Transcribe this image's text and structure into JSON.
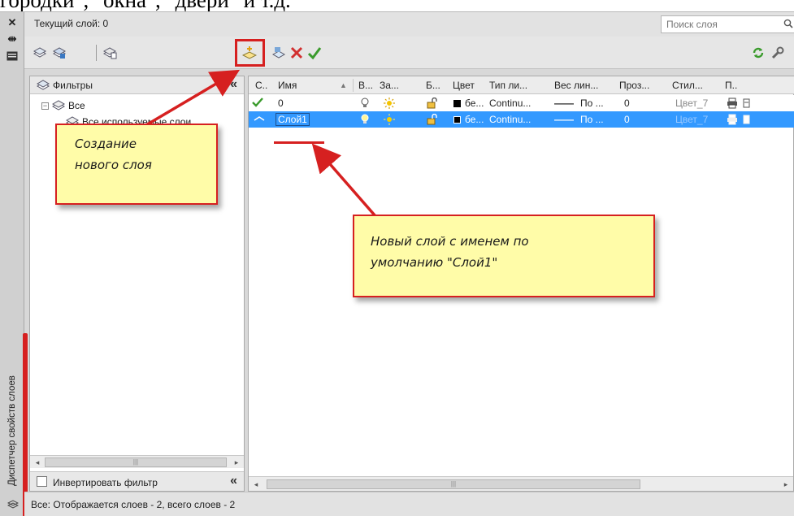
{
  "caption": "городки\", \"окна\", \"двери\" и т.д.",
  "sidebar": {
    "title": "Диспетчер свойств слоев"
  },
  "header": {
    "current_layer": "Текущий слой: 0",
    "search_placeholder": "Поиск слоя"
  },
  "filters": {
    "title": "Фильтры",
    "tree_all": "Все",
    "tree_used": "Все используемые слои",
    "invert_label": "Инвертировать фильтр"
  },
  "columns": [
    "С..",
    "Имя",
    "В...",
    "За...",
    "Б...",
    "Цвет",
    "Тип ли...",
    "Вес лин...",
    "Проз...",
    "Стил...",
    "П.."
  ],
  "rows": [
    {
      "name": "0",
      "color": "бе...",
      "linetype": "Continu...",
      "lineweight": "По ...",
      "transparency": "0",
      "plot_style": "Цвет_7"
    },
    {
      "name": "Слой1",
      "color": "бе...",
      "linetype": "Continu...",
      "lineweight": "По ...",
      "transparency": "0",
      "plot_style": "Цвет_7"
    }
  ],
  "status": "Все: Отображается слоев - 2, всего слоев - 2",
  "annotations": {
    "note1_line1": "Создание",
    "note1_line2": "нового слоя",
    "note2_line1": "Новый слой с именем по",
    "note2_line2": "умолчанию \"Слой1\""
  },
  "colors": {
    "accent_red": "#d62020",
    "selection_blue": "#3399ff",
    "note_yellow": "#fffca8"
  }
}
